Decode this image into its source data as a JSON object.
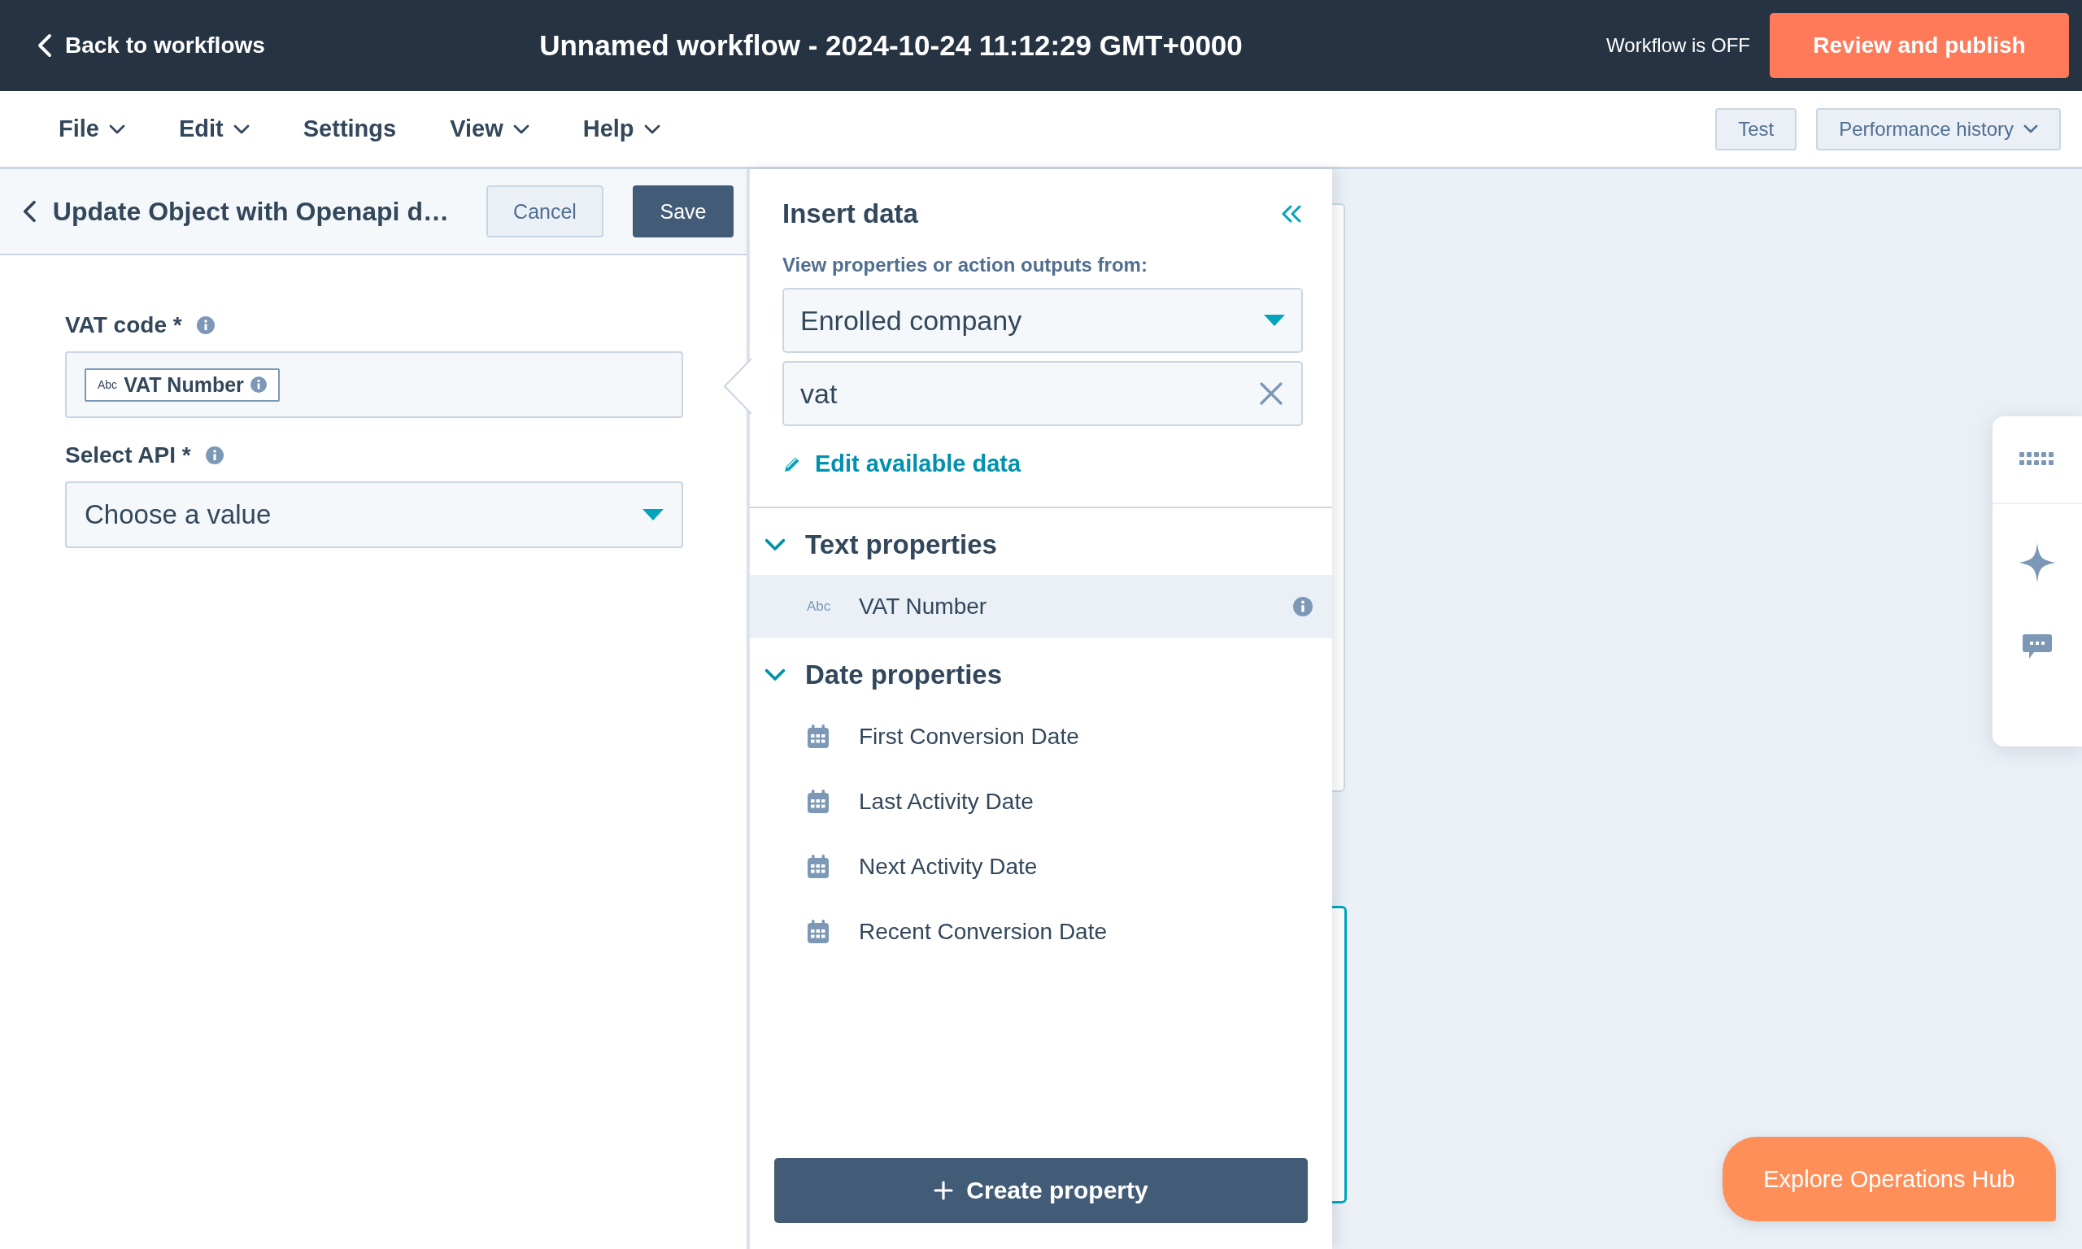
{
  "header": {
    "back_link": "Back to workflows",
    "title": "Unnamed workflow - 2024-10-24 11:12:29 GMT+0000",
    "status": "Workflow is OFF",
    "publish_button": "Review and publish"
  },
  "menu": [
    {
      "label": "File",
      "dropdown": true
    },
    {
      "label": "Edit",
      "dropdown": true
    },
    {
      "label": "Settings",
      "dropdown": false
    },
    {
      "label": "View",
      "dropdown": true
    },
    {
      "label": "Help",
      "dropdown": true
    }
  ],
  "toolbar_buttons": [
    {
      "label": "Test",
      "dropdown": false
    },
    {
      "label": "Performance history",
      "dropdown": true
    }
  ],
  "action_panel": {
    "title": "Update Object with Openapi d…",
    "cancel_button": "Cancel",
    "save_button": "Save",
    "fields": [
      {
        "kind": "token",
        "label": "VAT code *",
        "token_type": "Abc",
        "token": "VAT Number"
      },
      {
        "kind": "select",
        "label": "Select API *",
        "placeholder": "Choose a value"
      }
    ]
  },
  "insert_panel": {
    "title": "Insert data",
    "source_label": "View properties or action outputs from:",
    "source": "Enrolled company",
    "search": "vat",
    "edit_link": "Edit available data",
    "groups": [
      {
        "title": "Text properties",
        "expanded": true,
        "items": [
          {
            "kind": "text",
            "type_label": "Abc",
            "label": "VAT Number",
            "selected": true,
            "info": true
          }
        ]
      },
      {
        "title": "Date properties",
        "expanded": true,
        "items": [
          {
            "kind": "date",
            "label": "First Conversion Date",
            "selected": false,
            "info": false
          },
          {
            "kind": "date",
            "label": "Last Activity Date",
            "selected": false,
            "info": false
          },
          {
            "kind": "date",
            "label": "Next Activity Date",
            "selected": false,
            "info": false
          },
          {
            "kind": "date",
            "label": "Recent Conversion Date",
            "selected": false,
            "info": false
          }
        ]
      }
    ],
    "create_button": "Create property"
  },
  "explore_button": "Explore Operations Hub"
}
